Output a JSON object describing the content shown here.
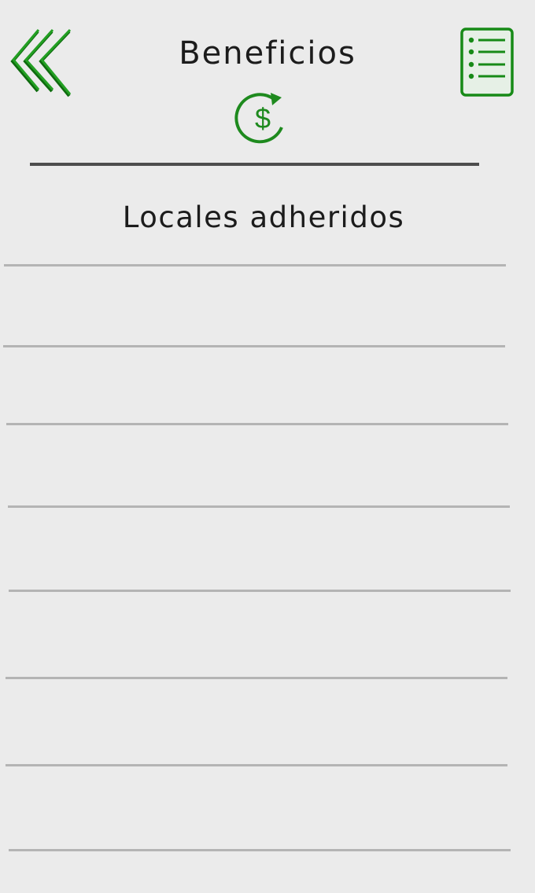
{
  "header": {
    "title": "Beneficios",
    "back_icon": "double-chevron-left-icon",
    "menu_icon": "list-icon",
    "dollar_icon": "dollar-refresh-icon",
    "accent_color": "#1e8a1e"
  },
  "section": {
    "title": "Locales adheridos"
  },
  "locales": [
    {
      "name": ""
    },
    {
      "name": ""
    },
    {
      "name": ""
    },
    {
      "name": ""
    },
    {
      "name": ""
    },
    {
      "name": ""
    },
    {
      "name": ""
    }
  ]
}
